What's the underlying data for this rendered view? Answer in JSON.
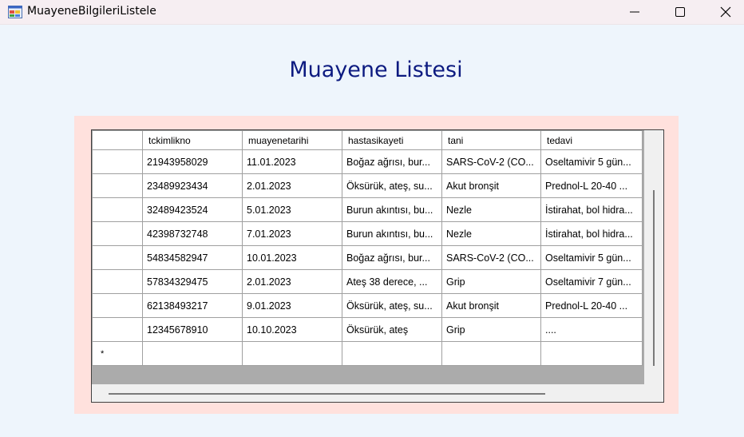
{
  "window": {
    "title": "MuayeneBilgileriListele"
  },
  "heading": "Muayene Listesi",
  "grid": {
    "columns": [
      "tckimlikno",
      "muayenetarihi",
      "hastasikayeti",
      "tani",
      "tedavi"
    ],
    "rows": [
      [
        "21943958029",
        "11.01.2023",
        "Boğaz ağrısı, bur...",
        "SARS-CoV-2 (CO...",
        "Oseltamivir 5 gün..."
      ],
      [
        "23489923434",
        "2.01.2023",
        "Öksürük, ateş, su...",
        "Akut bronşit",
        "Prednol-L 20-40 ..."
      ],
      [
        "32489423524",
        "5.01.2023",
        "Burun akıntısı, bu...",
        "Nezle",
        "İstirahat, bol hidra..."
      ],
      [
        "42398732748",
        "7.01.2023",
        "Burun akıntısı, bu...",
        "Nezle",
        "İstirahat, bol hidra..."
      ],
      [
        "54834582947",
        "10.01.2023",
        "Boğaz ağrısı, bur...",
        "SARS-CoV-2 (CO...",
        "Oseltamivir 5 gün..."
      ],
      [
        "57834329475",
        "2.01.2023",
        "Ateş 38 derece, ...",
        "Grip",
        "Oseltamivir 7 gün..."
      ],
      [
        "62138493217",
        "9.01.2023",
        "Öksürük, ateş, su...",
        "Akut bronşit",
        "Prednol-L 20-40 ..."
      ],
      [
        "12345678910",
        "10.10.2023",
        "Öksürük, ateş",
        "Grip",
        "...."
      ]
    ],
    "new_row_marker": "*"
  },
  "colors": {
    "background": "#eef5fc",
    "panel": "#ffe1dd",
    "heading": "#0c1a80",
    "grid_background": "#ababab"
  },
  "icons": {
    "app": "app-form-icon",
    "minimize": "minimize-icon",
    "maximize": "maximize-icon",
    "close": "close-icon"
  }
}
